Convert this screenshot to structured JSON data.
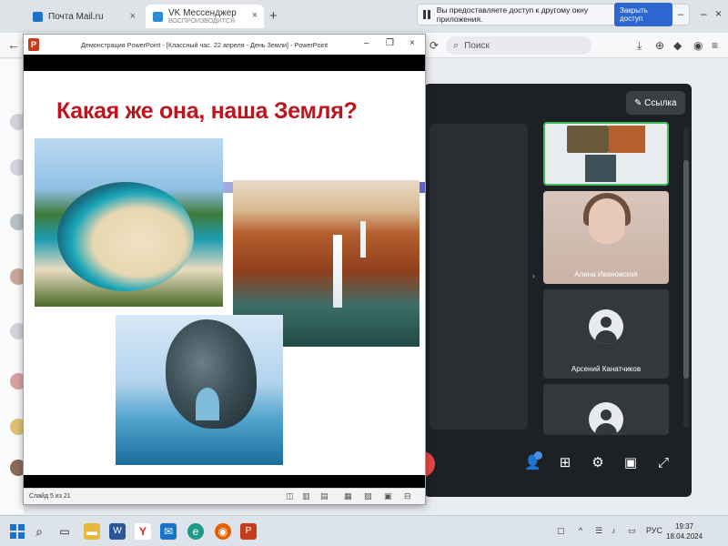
{
  "browser": {
    "tabs": [
      {
        "label": "Почта Mail.ru"
      },
      {
        "label": "VK Мессенджер",
        "sublabel": "ВОСПРОИЗВОДИТСЯ"
      }
    ],
    "new_tab_label": "+",
    "sharing_notice": {
      "text": "Вы предоставляете доступ к другому окну приложения.",
      "button_label": "Закрыть доступ"
    },
    "search_placeholder": "Поиск"
  },
  "call": {
    "link_button_label": "✎ Ссылка",
    "participants": [
      {
        "name": "Алина Ивановская"
      },
      {
        "name": "Арсений Канатчиков"
      }
    ]
  },
  "powerpoint": {
    "window_title": "Демонстрация PowerPoint - [Классный час. 22 апреля - День Земли] - PowerPoint",
    "slide": {
      "title": "Какая же она, наша Земля?"
    },
    "status": {
      "slide_counter": "Слайд 5 из 21"
    }
  },
  "taskbar": {
    "language": "РУС",
    "time": "19:37",
    "date": "18.04.2024"
  },
  "colors": {
    "slide_title": "#c0141d",
    "accent_blue": "#2c66d1",
    "call_bg": "#1e2124",
    "active_tile_border": "#3fbf57",
    "powerpoint_red": "#c43e1c"
  }
}
